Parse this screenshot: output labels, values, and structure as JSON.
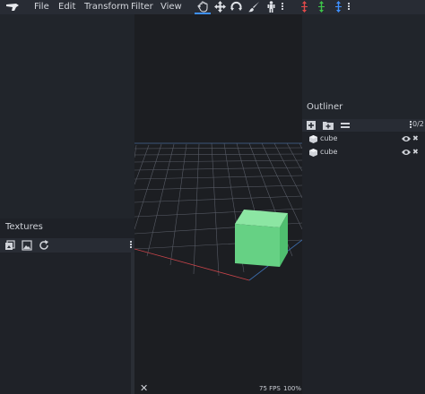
{
  "menubar": {
    "items": [
      "File",
      "Edit",
      "Transform",
      "Filter",
      "View"
    ]
  },
  "tools": {
    "icons": [
      "move-hand-icon",
      "translate-icon",
      "rotate-icon",
      "paint-brush-icon",
      "figure-icon",
      "more-icon",
      "move-x-icon",
      "move-y-icon",
      "move-z-icon",
      "more-icon"
    ],
    "active": "move-hand-icon",
    "colors": {
      "accent": "#3e90ff",
      "x": "#e04a4a",
      "y": "#3ec44a",
      "z": "#3e90ff"
    }
  },
  "textures": {
    "title": "Textures",
    "toolbar_icons": [
      "import-texture-icon",
      "image-icon",
      "refresh-icon",
      "more-icon"
    ]
  },
  "viewport": {
    "close_label": "✕",
    "fps": "75 FPS",
    "zoom": "100%",
    "cube_color": "#6cd68a"
  },
  "outliner": {
    "title": "Outliner",
    "toolbar_icons": [
      "add-cube-icon",
      "add-group-icon",
      "collapse-icon",
      "more-icon"
    ],
    "count": "0/2",
    "items": [
      {
        "name": "cube",
        "icon": "cube-icon",
        "visible": true
      },
      {
        "name": "cube",
        "icon": "cube-icon",
        "visible": true
      }
    ]
  }
}
